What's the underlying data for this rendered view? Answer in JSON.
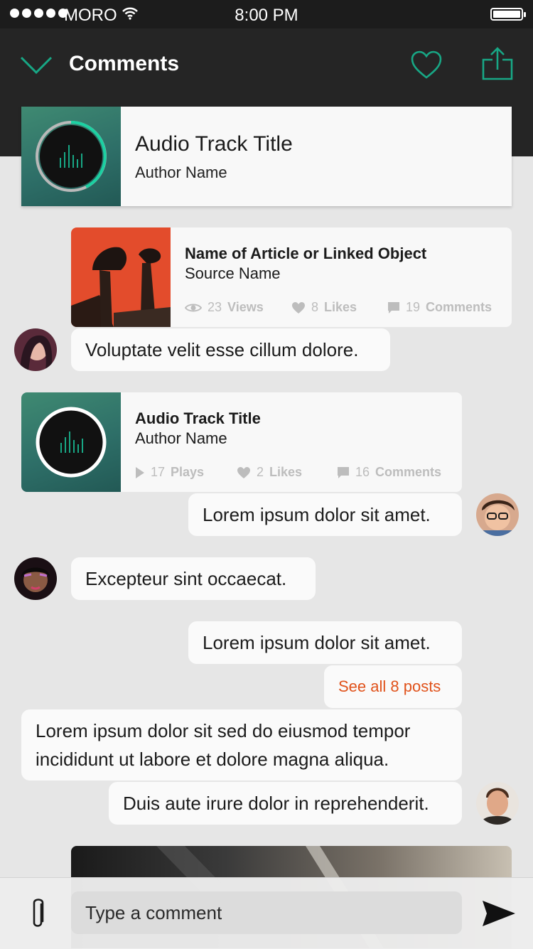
{
  "status_bar": {
    "carrier": "MORO",
    "time": "8:00 PM"
  },
  "header": {
    "title": "Comments"
  },
  "top_track": {
    "title": "Audio Track Title",
    "author": "Author Name"
  },
  "article": {
    "title": "Name of Article or Linked Object",
    "source": "Source Name",
    "views_num": "23",
    "views_label": "Views",
    "likes_num": "8",
    "likes_label": "Likes",
    "comments_num": "19",
    "comments_label": "Comments"
  },
  "track": {
    "title": "Audio Track Title",
    "author": "Author Name",
    "plays_num": "17",
    "plays_label": "Plays",
    "likes_num": "2",
    "likes_label": "Likes",
    "comments_num": "16",
    "comments_label": "Comments"
  },
  "messages": [
    "Voluptate velit esse cillum dolore.",
    "Lorem ipsum dolor sit amet.",
    "Excepteur sint occaecat.",
    "Lorem ipsum dolor sit amet.",
    "Lorem ipsum dolor sit sed do eiusmod tempor incididunt ut labore et dolore magna aliqua.",
    "Duis aute irure dolor in reprehenderit."
  ],
  "see_all": "See all 8 posts",
  "composer": {
    "placeholder": "Type a comment"
  },
  "colors": {
    "accent": "#18a785",
    "link": "#e0521b",
    "header_bg": "#252525"
  },
  "icons": [
    "chevron-down-icon",
    "heart-icon",
    "share-icon",
    "eye-icon",
    "comment-icon",
    "play-icon",
    "paperclip-icon",
    "send-icon"
  ]
}
